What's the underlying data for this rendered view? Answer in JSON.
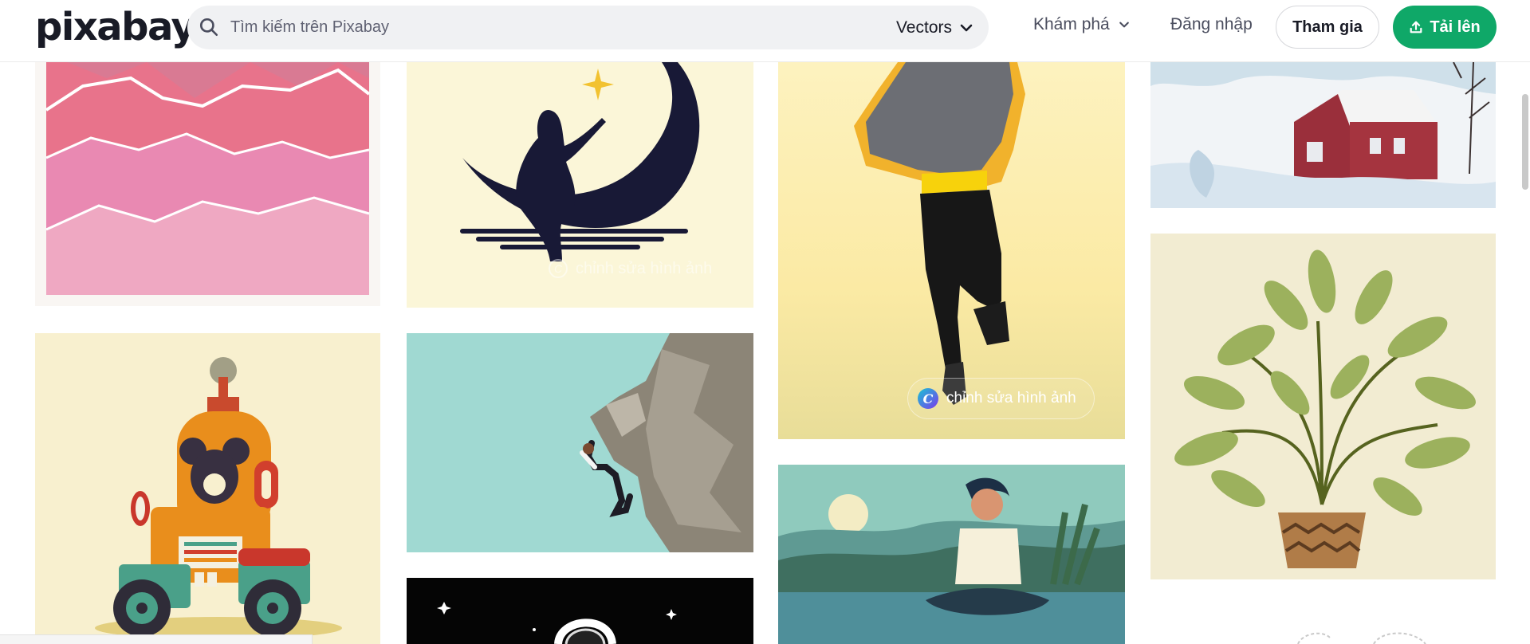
{
  "header": {
    "logo": "pixabay",
    "search": {
      "placeholder": "Tìm kiếm trên Pixabay",
      "value": ""
    },
    "filter": {
      "selected": "Vectors"
    },
    "nav": {
      "explore": "Khám phá",
      "login": "Đăng nhập",
      "join": "Tham gia",
      "upload": "Tải lên"
    }
  },
  "gallery": {
    "canva_label": "chỉnh sửa hình ảnh",
    "items": [
      {
        "subject": "pink mountain layers"
      },
      {
        "subject": "woman sitting on crescent moon"
      },
      {
        "subject": "man jumping in yellow jacket"
      },
      {
        "subject": "red house in snowy landscape"
      },
      {
        "subject": "mouse driving retro car"
      },
      {
        "subject": "rock climber on cliff"
      },
      {
        "subject": "potted green plant"
      },
      {
        "subject": "man meditating by lake"
      },
      {
        "subject": "astronaut in space"
      }
    ]
  },
  "colors": {
    "brand": "#0fa868",
    "text": "#191b26"
  }
}
